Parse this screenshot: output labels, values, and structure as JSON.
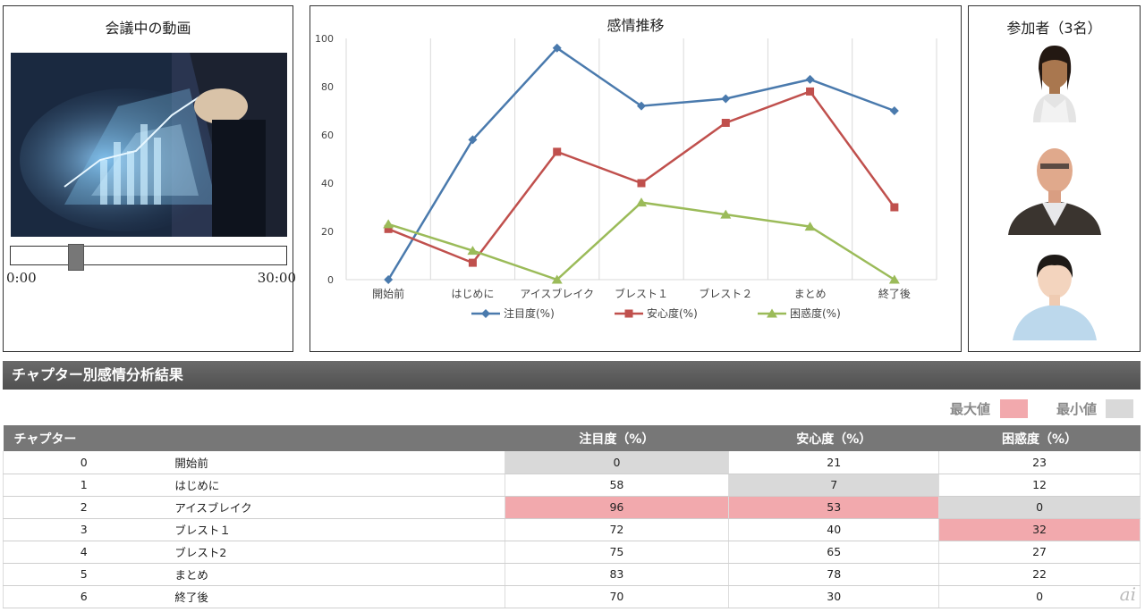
{
  "video": {
    "title": "会議中の動画",
    "time_start": "0:00",
    "time_end": "30:00",
    "seek_position": 0.22
  },
  "chart_title": "感情推移",
  "participants": {
    "title": "参加者（3名）",
    "people": [
      {
        "icon": "female-avatar-icon"
      },
      {
        "icon": "male-avatar-icon"
      },
      {
        "icon": "female-avatar-icon"
      }
    ]
  },
  "section": {
    "title": "チャプター別感情分析結果"
  },
  "legend": {
    "max_label": "最大値",
    "min_label": "最小値",
    "max_color": "#f2a9ad",
    "min_color": "#d9d9d9"
  },
  "table": {
    "headers": [
      "チャプター",
      "",
      "注目度（%）",
      "安心度（%）",
      "困惑度（%）"
    ],
    "rows": [
      {
        "no": "0",
        "name": "開始前",
        "attention": "0",
        "relief": "21",
        "confusion": "23"
      },
      {
        "no": "1",
        "name": "はじめに",
        "attention": "58",
        "relief": "7",
        "confusion": "12"
      },
      {
        "no": "2",
        "name": "アイスブレイク",
        "attention": "96",
        "relief": "53",
        "confusion": "0"
      },
      {
        "no": "3",
        "name": "ブレスト１",
        "attention": "72",
        "relief": "40",
        "confusion": "32"
      },
      {
        "no": "4",
        "name": "ブレスト2",
        "attention": "75",
        "relief": "65",
        "confusion": "27"
      },
      {
        "no": "5",
        "name": "まとめ",
        "attention": "83",
        "relief": "78",
        "confusion": "22"
      },
      {
        "no": "6",
        "name": "終了後",
        "attention": "70",
        "relief": "30",
        "confusion": "0"
      }
    ],
    "highlights": {
      "attention": {
        "max": 2,
        "min": 0
      },
      "relief": {
        "max": 2,
        "min": 1
      },
      "confusion": {
        "max": 3,
        "min": 2
      }
    }
  },
  "chart_data": {
    "type": "line",
    "title": "感情推移",
    "categories": [
      "開始前",
      "はじめに",
      "アイスブレイク",
      "ブレスト１",
      "ブレスト２",
      "まとめ",
      "終了後"
    ],
    "ylim": [
      0,
      100
    ],
    "yticks": [
      0,
      20,
      40,
      60,
      80,
      100
    ],
    "grid": "vertical",
    "legend_position": "bottom",
    "series": [
      {
        "name": "注目度(%)",
        "values": [
          0,
          58,
          96,
          72,
          75,
          83,
          70
        ],
        "color": "#4a7aad",
        "marker": "diamond"
      },
      {
        "name": "安心度(%)",
        "values": [
          21,
          7,
          53,
          40,
          65,
          78,
          30
        ],
        "color": "#c0504d",
        "marker": "square"
      },
      {
        "name": "困惑度(%)",
        "values": [
          23,
          12,
          0,
          32,
          27,
          22,
          0
        ],
        "color": "#9bbb59",
        "marker": "triangle"
      }
    ]
  },
  "watermark": "ai"
}
